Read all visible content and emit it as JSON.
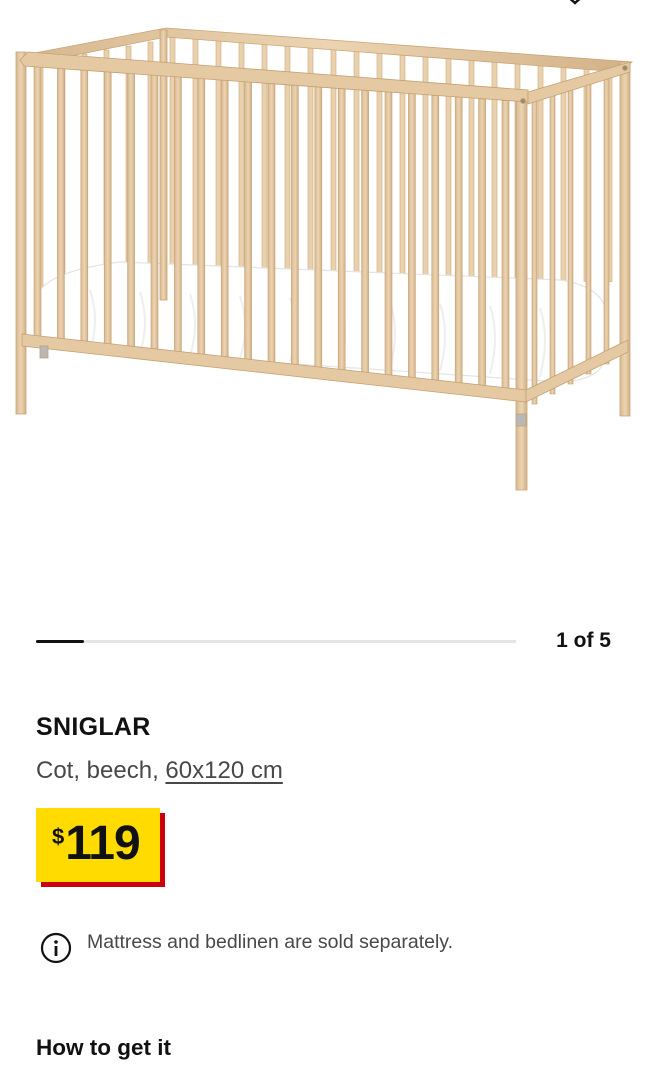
{
  "product": {
    "name": "SNIGLAR",
    "description_prefix": "Cot, beech, ",
    "size": "60x120 cm",
    "price": {
      "currency": "$",
      "amount": "119"
    },
    "image_alt": "SNIGLAR cot in beech with white mattress"
  },
  "gallery": {
    "counter": "1 of 5",
    "current": 1,
    "total": 5,
    "progress_fraction": 0.2
  },
  "notice": {
    "text": "Mattress and bedlinen are sold separately.",
    "icon": "info-icon"
  },
  "delivery": {
    "heading": "How to get it"
  },
  "colors": {
    "price_badge": "#ffdb00",
    "price_shadow": "#cc0008",
    "wood": "#e3c9a5",
    "mattress": "#ffffff"
  },
  "icons": {
    "favourite": "heart-icon"
  }
}
